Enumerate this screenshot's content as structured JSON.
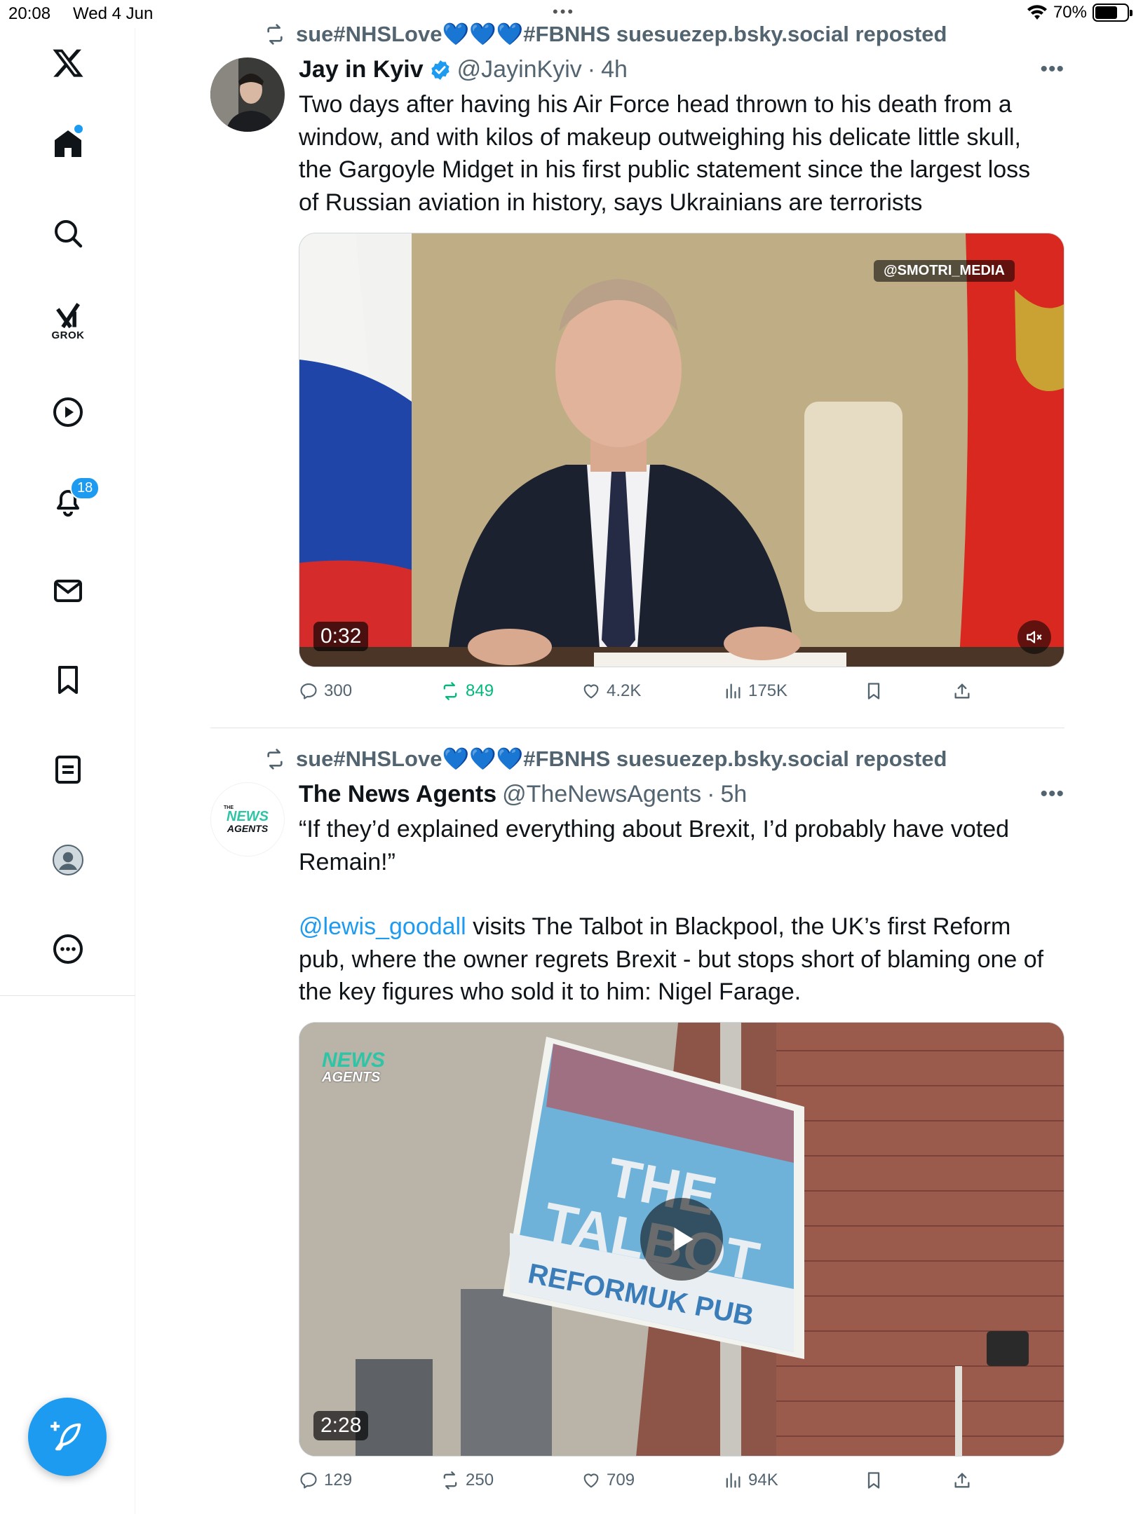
{
  "status": {
    "time": "20:08",
    "date": "Wed 4 Jun",
    "battery": "70%"
  },
  "sidebar": {
    "items": [
      {
        "name": "x-logo"
      },
      {
        "name": "home",
        "has_dot": true
      },
      {
        "name": "search"
      },
      {
        "name": "grok",
        "label": "GROK"
      },
      {
        "name": "video"
      },
      {
        "name": "notifications",
        "badge": "18"
      },
      {
        "name": "messages"
      },
      {
        "name": "bookmarks"
      },
      {
        "name": "lists"
      },
      {
        "name": "profile"
      },
      {
        "name": "more"
      }
    ],
    "compose_icon": "feather-plus-icon"
  },
  "colors": {
    "accent": "#1d9bf0",
    "repost_green": "#00ba7c",
    "muted": "#536471"
  },
  "posts": [
    {
      "repost_by": "sue#NHSLove",
      "repost_hearts": "💙💙💙",
      "repost_rest": "#FBNHS suesuezep.bsky.social reposted",
      "author_name": "Jay in Kyiv",
      "verified": true,
      "handle": "@JayinKyiv",
      "age": "4h",
      "text": "Two days after having his Air Force head thrown to his death from a window, and with kilos of makeup outweighing his delicate little skull, the Gargoyle Midget in his first public statement since the largest loss of Russian aviation in history, says Ukrainians are terrorists",
      "media": {
        "watermark": "@SMOTRI_MEDIA",
        "duration": "0:32",
        "muted": true
      },
      "stats": {
        "replies": "300",
        "reposts": "849",
        "likes": "4.2K",
        "views": "175K"
      }
    },
    {
      "repost_by": "sue#NHSLove",
      "repost_hearts": "💙💙💙",
      "repost_rest": "#FBNHS suesuezep.bsky.social reposted",
      "author_name": "The News Agents",
      "verified": false,
      "handle": "@TheNewsAgents",
      "age": "5h",
      "avatar_text_top": "NEWS",
      "avatar_text_bottom": "AGENTS",
      "avatar_small": "THE",
      "text_line1": "“If they’d explained everything about Brexit, I’d probably have voted Remain!”",
      "mention": "@lewis_goodall",
      "text_line2": " visits The Talbot in Blackpool, the UK’s first Reform pub, where the owner regrets Brexit - but stops short of blaming one of the key figures who sold it to him: Nigel Farage.",
      "media": {
        "logo_top": "NEWS",
        "logo_bottom": "AGENTS",
        "sign_line1": "THE",
        "sign_line2": "TALBOT",
        "sign_line3": "REFORMUK PUB",
        "duration": "2:28"
      },
      "stats": {
        "replies": "129",
        "reposts": "250",
        "likes": "709",
        "views": "94K"
      }
    }
  ]
}
